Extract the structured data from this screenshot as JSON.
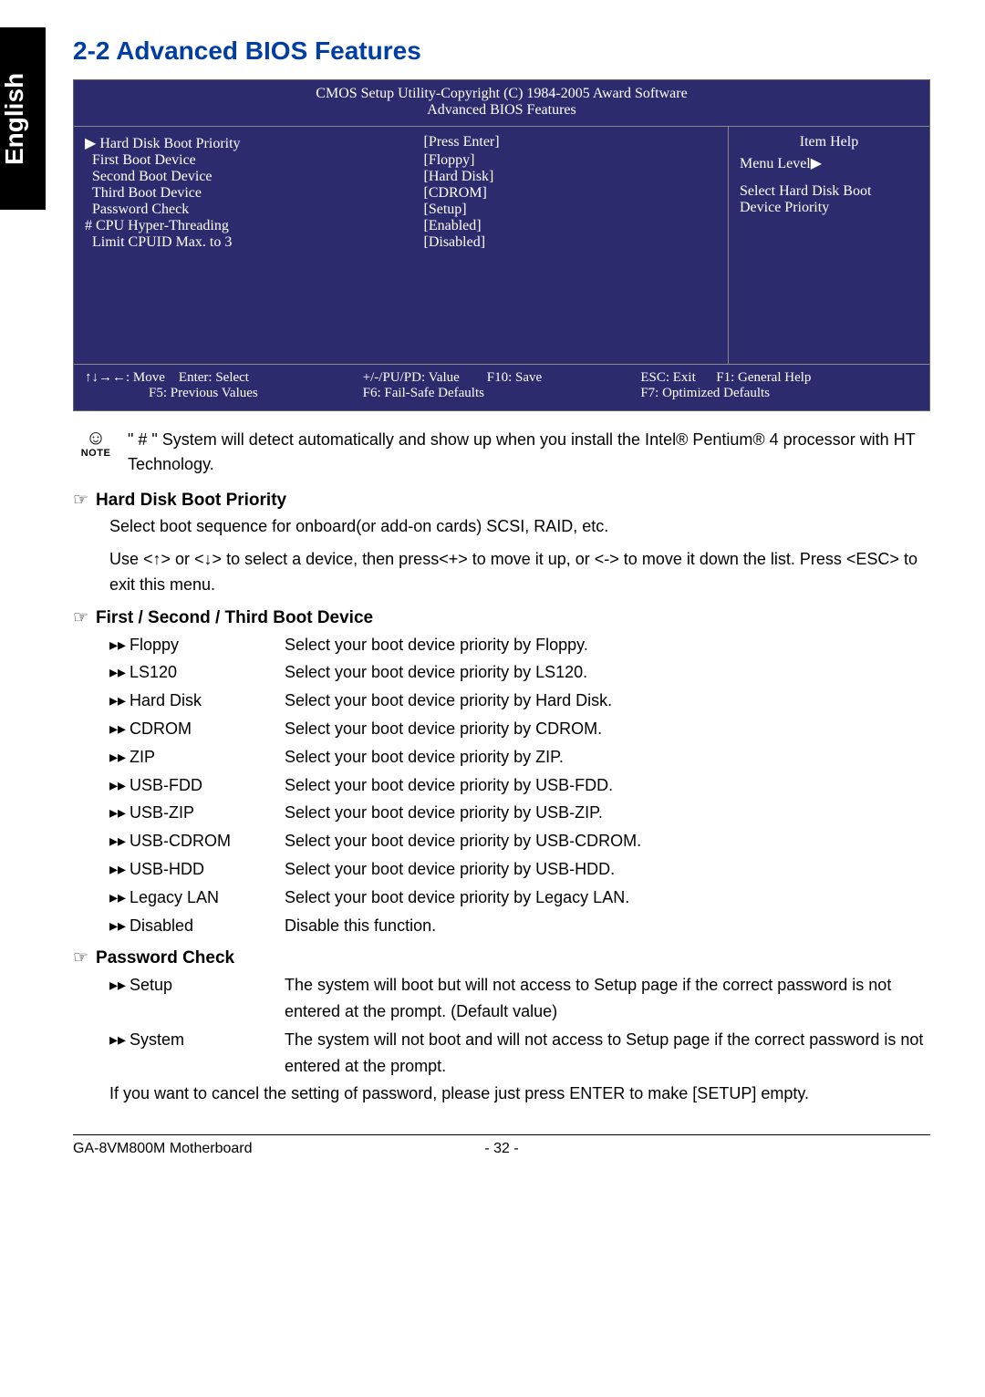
{
  "sideTab": "English",
  "sectionTitle": "2-2    Advanced BIOS Features",
  "bios": {
    "headerLine1": "CMOS Setup Utility-Copyright (C) 1984-2005 Award Software",
    "headerLine2": "Advanced BIOS Features",
    "items": [
      {
        "prefix": "▶",
        "label": "Hard Disk Boot Priority",
        "value": "[Press Enter]"
      },
      {
        "prefix": "",
        "label": "First Boot Device",
        "value": "[Floppy]"
      },
      {
        "prefix": "",
        "label": "Second Boot Device",
        "value": "[Hard Disk]"
      },
      {
        "prefix": "",
        "label": "Third Boot Device",
        "value": "[CDROM]"
      },
      {
        "prefix": "",
        "label": "Password Check",
        "value": "[Setup]"
      },
      {
        "prefix": "#",
        "label": "CPU Hyper-Threading",
        "value": "[Enabled]"
      },
      {
        "prefix": "",
        "label": "Limit CPUID Max. to 3",
        "value": "[Disabled]"
      }
    ],
    "help": {
      "title": "Item Help",
      "menuLevel": "Menu Level▶",
      "line1": "Select Hard Disk Boot",
      "line2": "Device Priority"
    },
    "footer": {
      "c1a": "↑↓→←: Move",
      "c1b": "Enter: Select",
      "c1c": "F5: Previous Values",
      "c2a": "+/-/PU/PD: Value",
      "c2b": "F10: Save",
      "c2c": "F6: Fail-Safe Defaults",
      "c3a": "ESC: Exit",
      "c3b": "F1: General Help",
      "c3c": "F7: Optimized Defaults"
    }
  },
  "note": "\" # \" System will detect automatically and show up when you install the Intel® Pentium® 4 processor with HT Technology.",
  "noteLabel": "NOTE",
  "hd": {
    "title": "Hard Disk Boot Priority",
    "p1": "Select boot sequence for onboard(or add-on cards) SCSI, RAID, etc.",
    "p2": "Use <↑> or <↓> to select a device, then press<+> to move it up, or <-> to move it down the list. Press <ESC> to exit this menu."
  },
  "boot": {
    "title": "First / Second / Third Boot Device",
    "opts": [
      {
        "name": "Floppy",
        "desc": "Select your boot device priority by Floppy."
      },
      {
        "name": "LS120",
        "desc": "Select your boot device priority by LS120."
      },
      {
        "name": "Hard Disk",
        "desc": "Select your boot device priority by Hard Disk."
      },
      {
        "name": "CDROM",
        "desc": "Select your boot device priority by CDROM."
      },
      {
        "name": "ZIP",
        "desc": "Select your boot device priority by ZIP."
      },
      {
        "name": "USB-FDD",
        "desc": "Select your boot device priority by USB-FDD."
      },
      {
        "name": "USB-ZIP",
        "desc": "Select your boot device priority by USB-ZIP."
      },
      {
        "name": "USB-CDROM",
        "desc": "Select your boot device priority by USB-CDROM."
      },
      {
        "name": "USB-HDD",
        "desc": "Select your boot device priority by USB-HDD."
      },
      {
        "name": "Legacy LAN",
        "desc": "Select your boot device priority by Legacy LAN."
      },
      {
        "name": "Disabled",
        "desc": "Disable this function."
      }
    ]
  },
  "pw": {
    "title": "Password Check",
    "opts": [
      {
        "name": "Setup",
        "desc": "The system will boot but will not access to Setup page if the correct password is not entered at the prompt. (Default value)"
      },
      {
        "name": "System",
        "desc": "The system will not boot and will not access to Setup page if the correct password is not entered at the prompt."
      }
    ],
    "cancel": "If you want to cancel the setting of password, please just press ENTER to make [SETUP] empty."
  },
  "footerBar": {
    "left": "GA-8VM800M Motherboard",
    "center": "- 32 -"
  },
  "glyphs": {
    "hand": "☞",
    "arrow": "▸▸"
  }
}
